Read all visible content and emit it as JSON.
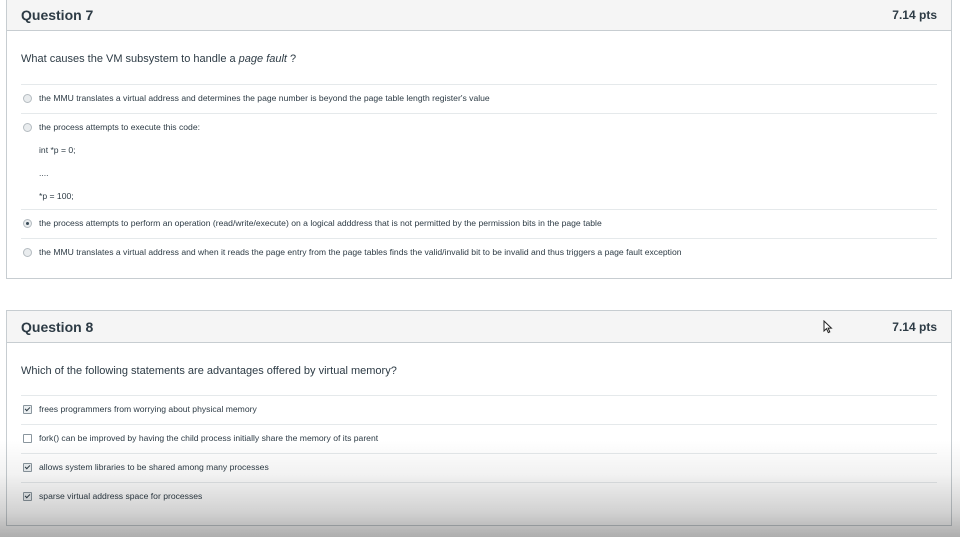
{
  "q7": {
    "title": "Question 7",
    "points": "7.14 pts",
    "prompt_prefix": "What causes  the VM subsystem  to handle a ",
    "prompt_em": "page fault",
    "prompt_suffix": " ?",
    "answers": [
      {
        "lines": [
          "the MMU translates a virtual address and determines the page number is beyond the page table length register's value"
        ],
        "selected": false
      },
      {
        "lines": [
          "the process attempts to execute this code:",
          "int *p = 0;",
          "....",
          "*p = 100;"
        ],
        "selected": false
      },
      {
        "lines": [
          "the process attempts to perform an operation (read/write/execute) on a logical adddress that is not permitted by the permission bits in the page table"
        ],
        "selected": true
      },
      {
        "lines": [
          "the MMU translates a virtual address and when it reads the page entry from the page tables finds the valid/invalid bit to be invalid and thus triggers a page fault exception"
        ],
        "selected": false
      }
    ]
  },
  "q8": {
    "title": "Question 8",
    "points": "7.14 pts",
    "prompt": "Which of the following statements are advantages offered by virtual memory?",
    "answers": [
      {
        "label": "frees programmers from worrying about physical memory",
        "checked": true
      },
      {
        "label": "fork() can be improved by having the child process initially share the memory of its parent",
        "checked": false
      },
      {
        "label": "allows system libraries to be shared among many processes",
        "checked": true
      },
      {
        "label": "sparse virtual address space for processes",
        "checked": true
      }
    ]
  }
}
